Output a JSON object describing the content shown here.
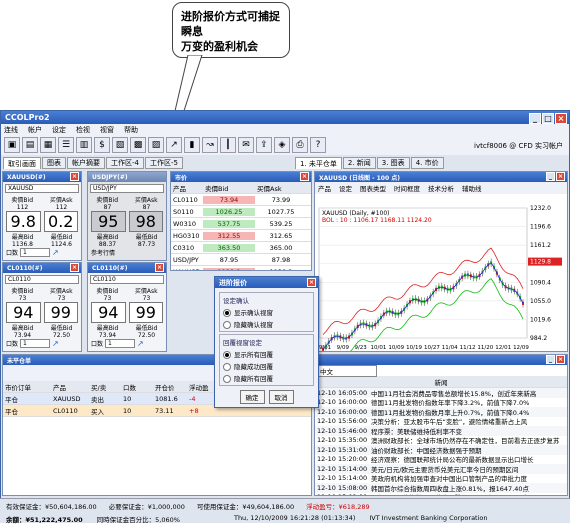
{
  "callout": {
    "line1": "进阶报价方式可捕捉瞬息",
    "line2": "万变的盈利机会"
  },
  "app": {
    "title": "CCOLPro2",
    "account": "ivtcf8006 @ CFD 实习帐户"
  },
  "menu": [
    "连线",
    "帐户",
    "设定",
    "检视",
    "视窗",
    "帮助"
  ],
  "tabs": [
    "取引画面",
    "图表",
    "帐户摘要",
    "工作区-4",
    "工作区-5"
  ],
  "right_tabs": [
    "1. 未平仓单",
    "2. 新闻",
    "3. 图表",
    "4. 市价"
  ],
  "quote1": {
    "title": "XAUUSD(#)",
    "symbol": "XAUUSD",
    "sell_label": "卖價Bid",
    "buy_label": "买價Ask",
    "sell_small": "112",
    "buy_small": "112",
    "sell_big": "9.8",
    "buy_big": "0.2",
    "high_label": "最高Bid",
    "low_label": "最低Bid",
    "high": "1136.8",
    "low": "1124.6",
    "qty_label": "口数",
    "qty": "1"
  },
  "quote2": {
    "title": "USDJPY(#)",
    "symbol": "USD/JPY",
    "sell_label": "卖價Bid",
    "buy_label": "买價Ask",
    "sell_small": "87",
    "buy_small": "87",
    "sell_big": "95",
    "buy_big": "98",
    "high_label": "最高Bid",
    "low_label": "最低Bid",
    "high": "88.37",
    "low": "87.73",
    "ref": "参考行情"
  },
  "quote3": {
    "title": "CL0110(#)",
    "symbol": "CL0110",
    "sell_label": "卖價Bid",
    "buy_label": "买價Ask",
    "sell_small": "73",
    "buy_small": "73",
    "sell_big": "94",
    "buy_big": "99",
    "high_label": "最高Bid",
    "low_label": "最低Bid",
    "high": "73.94",
    "low": "72.50",
    "qty_label": "口数",
    "qty": "1"
  },
  "quote4": {
    "title": "CL0110(#)",
    "symbol": "CL0110",
    "sell_label": "卖價Bid",
    "buy_label": "买價Ask",
    "sell_small": "73",
    "buy_small": "73",
    "sell_big": "94",
    "buy_big": "99",
    "high_label": "最高Bid",
    "low_label": "最低Bid",
    "high": "73.94",
    "low": "72.50",
    "qty_label": "口数",
    "qty": "1"
  },
  "market": {
    "title": "市价",
    "headers": [
      "产品",
      "卖價Bid",
      "买價Ask"
    ],
    "rows": [
      {
        "name": "CL0110",
        "bid": "73.94",
        "ask": "73.99",
        "c": "red"
      },
      {
        "name": "S0110",
        "bid": "1026.25",
        "ask": "1027.75",
        "c": "green"
      },
      {
        "name": "W0310",
        "bid": "537.75",
        "ask": "539.25",
        "c": "green"
      },
      {
        "name": "HG0310",
        "bid": "312.55",
        "ask": "312.65",
        "c": "red"
      },
      {
        "name": "C0310",
        "bid": "363.50",
        "ask": "365.00",
        "c": "green"
      },
      {
        "name": "USD/JPY",
        "bid": "87.95",
        "ask": "87.98",
        "c": ""
      },
      {
        "name": "XAUUSD",
        "bid": "1129.8",
        "ask": "1130.2",
        "c": "red"
      },
      {
        "name": "XAGUSD",
        "bid": "17.40",
        "ask": "17.44",
        "c": ""
      }
    ]
  },
  "chart": {
    "title": "XAUUSD (日线图 - 100 点)",
    "menu": [
      "产品",
      "设定",
      "图表类型",
      "时间框度",
      "技术分析",
      "辅助线"
    ],
    "label": "XAUUSD (Daily, #100)",
    "ohlc": "BOL : 10 : 1106.17 1168.11 1124.20",
    "yticks": [
      "1232.0",
      "1196.6",
      "1161.2",
      "1125.6",
      "1090.4",
      "1055.0",
      "1019.6",
      "984.2"
    ],
    "xticks": [
      "9/01",
      "9/09",
      "9/23",
      "10/01",
      "10/09",
      "10/19",
      "10/27",
      "11/04",
      "11/12",
      "11/20",
      "12/01",
      "12/09"
    ],
    "price_tag": "1129.8"
  },
  "dialog": {
    "title": "进阶报价",
    "group1": "设定确认",
    "opt1": "显示确认视窗",
    "opt2": "隐藏确认视窗",
    "group2": "回覆视窗设定",
    "opt3": "显示所有回覆",
    "opt4": "隐藏成功回覆",
    "opt5": "隐藏所有回覆",
    "ok": "确定",
    "cancel": "取消"
  },
  "positions": {
    "title": "未平仓单",
    "headers": [
      "市价订单",
      "产品",
      "买/卖",
      "口数",
      "开仓价",
      "浮动盈"
    ],
    "rows": [
      {
        "id": "平仓",
        "prod": "XAUUSD",
        "side": "卖出",
        "qty": "10",
        "price": "1081.6",
        "pl": "-4"
      },
      {
        "id": "平仓",
        "prod": "CL0110",
        "side": "买入",
        "qty": "10",
        "price": "73.11",
        "pl": "+8"
      }
    ]
  },
  "news": {
    "lang": "中文",
    "header": "新闻",
    "items": [
      [
        "12-10 16:05:00",
        "中国11月社会消费品零售总额增长15.8%，创近年来新高"
      ],
      [
        "12-10 16:00:00",
        "德国11月批发物价指数年率下降3.2%，前值下降7.0%"
      ],
      [
        "12-10 16:00:00",
        "德国11月批发物价指数月率上升0.7%，前值下降0.4%"
      ],
      [
        "12-10 15:56:00",
        "决策分析：亚太股市午后“变脸”，避险情绪重新占上风"
      ],
      [
        "12-10 15:46:00",
        "程序票：美联储维持低利率不变"
      ],
      [
        "12-10 15:35:00",
        "澳洲财政部长：全球市场仍然存在不确定性，目前看去正逐步复苏"
      ],
      [
        "12-10 15:31:00",
        "油价财政部长：中国经济数据强于预期"
      ],
      [
        "12-10 15:20:00",
        "经济观察：德国联邦统计局公布的最新数据显示出口增长"
      ],
      [
        "12-10 15:14:00",
        "美元/日元/欧元主要货币兑美元汇率今日的预期区间"
      ],
      [
        "12-10 15:14:00",
        "美政府机构将加强审查对中国出口管制产品的审批力度"
      ],
      [
        "12-10 15:08:00",
        "韩国首尔综合指数周四收盘上涨0.81%，报1647.40点"
      ],
      [
        "12-10 15:02:00",
        "日经225平均指数周四收盘下跌1.42%，报9862.82点"
      ],
      [
        "12-10 14:58:00",
        "加拿大：新屋价格指数10月上涨0.4%，符合市场预期"
      ]
    ]
  },
  "status": {
    "margin": "有效保证金：¥50,604,186.00",
    "required": "必要保证金：¥1,000,000",
    "usable": "可使用保证金：¥49,604,186.00",
    "float_label": "浮动盈亏：",
    "float": "¥618,289",
    "balance": "余額：¥51,222,475.00",
    "ratio": "同時保证金百分比：5,060%",
    "time": "Thu, 12/10/2009 16:21:28 (01:13:34)",
    "company": "IVT Investment Banking Corporation"
  }
}
